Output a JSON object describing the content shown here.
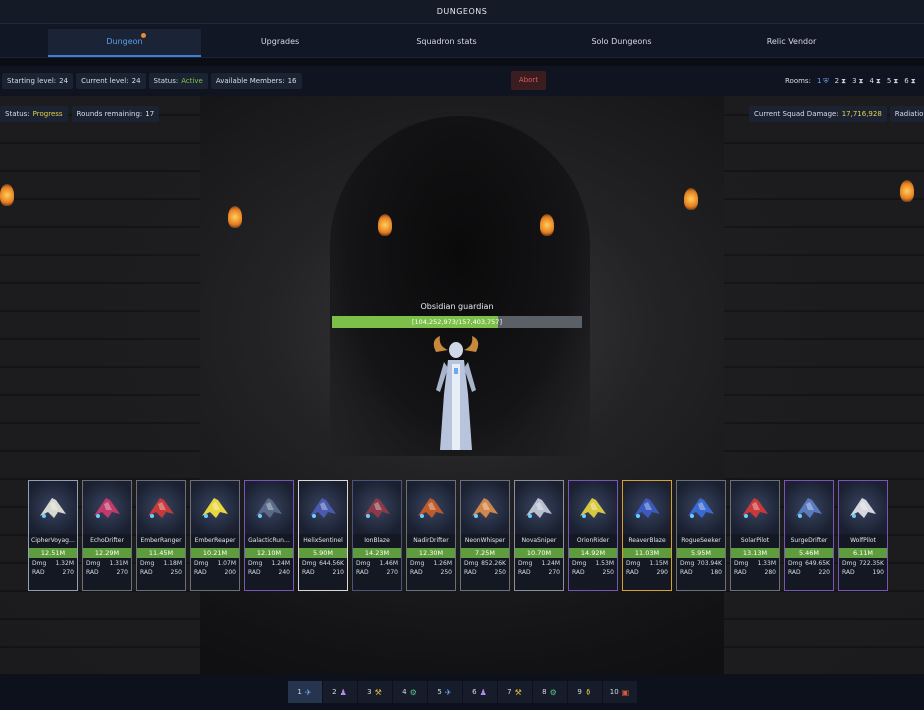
{
  "title": "DUNGEONS",
  "tabs": [
    {
      "label": "Dungeon",
      "active": true
    },
    {
      "label": "Upgrades"
    },
    {
      "label": "Squadron stats"
    },
    {
      "label": "Solo Dungeons"
    },
    {
      "label": "Relic Vendor"
    }
  ],
  "toolbar": {
    "starting_level_label": "Starting level:",
    "starting_level": "24",
    "current_level_label": "Current level:",
    "current_level": "24",
    "status_label": "Status:",
    "status": "Active",
    "members_label": "Available Members:",
    "members": "16",
    "abort_label": "Abort",
    "rooms_label": "Rooms:",
    "rooms": [
      {
        "num": "1",
        "icon": "shield-icon",
        "active": true
      },
      {
        "num": "2",
        "icon": "hourglass-icon"
      },
      {
        "num": "3",
        "icon": "hourglass-icon"
      },
      {
        "num": "4",
        "icon": "hourglass-icon"
      },
      {
        "num": "5",
        "icon": "hourglass-icon"
      },
      {
        "num": "6",
        "icon": "hourglass-icon"
      }
    ]
  },
  "battle": {
    "status_label": "Status:",
    "status": "Progress",
    "rounds_label": "Rounds remaining:",
    "rounds": "17",
    "damage_label": "Current Squad Damage:",
    "damage": "17,716,928",
    "radiation_label": "Radiatio",
    "boss_name": "Obsidian guardian",
    "boss_hp_text": "[104,252,973/157,403,757]",
    "boss_hp_fraction": 0.662
  },
  "colors": {
    "accent": "#3d7fd4",
    "green": "#7fc64a",
    "yellow": "#e3d34a",
    "abort": "#e05a5a"
  },
  "ships": [
    {
      "name": "CipherVoyag…",
      "total": "12.51M",
      "dmg": "1.32M",
      "rad": "270",
      "border": "#8fa0b8",
      "hull": "#d8d8d0"
    },
    {
      "name": "EchoDrifter",
      "total": "12.29M",
      "dmg": "1.31M",
      "rad": "270",
      "border": "#6b6f78",
      "hull": "#c03a6a"
    },
    {
      "name": "EmberRanger",
      "total": "11.45M",
      "dmg": "1.18M",
      "rad": "250",
      "border": "#6b6f78",
      "hull": "#c63a3a"
    },
    {
      "name": "EmberReaper",
      "total": "10.21M",
      "dmg": "1.07M",
      "rad": "200",
      "border": "#6b6f78",
      "hull": "#e8d840"
    },
    {
      "name": "GalacticRun…",
      "total": "12.10M",
      "dmg": "1.24M",
      "rad": "240",
      "border": "#7a55b8",
      "hull": "#5a6a88"
    },
    {
      "name": "HelixSentinel",
      "total": "5.90M",
      "dmg": "644.56K",
      "rad": "210",
      "border": "#d8d8d8",
      "hull": "#4a5ab0"
    },
    {
      "name": "IonBlaze",
      "total": "14.23M",
      "dmg": "1.46M",
      "rad": "270",
      "border": "#4a5578",
      "hull": "#8a3a48"
    },
    {
      "name": "NadirDrifter",
      "total": "12.30M",
      "dmg": "1.26M",
      "rad": "250",
      "border": "#6b6f78",
      "hull": "#c05a2a"
    },
    {
      "name": "NeonWhisper",
      "total": "7.25M",
      "dmg": "852.26K",
      "rad": "250",
      "border": "#6b6f78",
      "hull": "#d0864a"
    },
    {
      "name": "NovaSniper",
      "total": "10.70M",
      "dmg": "1.24M",
      "rad": "270",
      "border": "#8a8f98",
      "hull": "#b8c0d0"
    },
    {
      "name": "OrionRider",
      "total": "14.92M",
      "dmg": "1.53M",
      "rad": "250",
      "border": "#7a55b8",
      "hull": "#d8c840"
    },
    {
      "name": "ReaverBlaze",
      "total": "11.03M",
      "dmg": "1.15M",
      "rad": "290",
      "border": "#d8a030",
      "hull": "#3a5ac0"
    },
    {
      "name": "RogueSeeker",
      "total": "5.95M",
      "dmg": "703.94K",
      "rad": "180",
      "border": "#6b6f78",
      "hull": "#3a6ad0"
    },
    {
      "name": "SolarPilot",
      "total": "13.13M",
      "dmg": "1.33M",
      "rad": "280",
      "border": "#6b6f78",
      "hull": "#c83a3a"
    },
    {
      "name": "SurgeDrifter",
      "total": "5.46M",
      "dmg": "649.65K",
      "rad": "220",
      "border": "#7a55b8",
      "hull": "#5a7ac0"
    },
    {
      "name": "WolfPilot",
      "total": "6.11M",
      "dmg": "722.35K",
      "rad": "190",
      "border": "#7a55b8",
      "hull": "#d8d8e0"
    }
  ],
  "stat_labels": {
    "dmg": "Dmg",
    "rad": "RAD"
  },
  "pages": [
    {
      "num": "1",
      "icon": "ship-icon",
      "glyph": "✈",
      "color": "#6aa8ef",
      "active": true
    },
    {
      "num": "2",
      "icon": "people-icon",
      "glyph": "♟",
      "color": "#b88ae8"
    },
    {
      "num": "3",
      "icon": "hammer-icon",
      "glyph": "⚒",
      "color": "#e8b84a"
    },
    {
      "num": "4",
      "icon": "gear-badge-icon",
      "glyph": "⚙",
      "color": "#5ac08a"
    },
    {
      "num": "5",
      "icon": "ship-icon",
      "glyph": "✈",
      "color": "#6aa8ef"
    },
    {
      "num": "6",
      "icon": "people-icon",
      "glyph": "♟",
      "color": "#b88ae8"
    },
    {
      "num": "7",
      "icon": "hammer-icon",
      "glyph": "⚒",
      "color": "#e8b84a"
    },
    {
      "num": "8",
      "icon": "gear-badge-icon",
      "glyph": "⚙",
      "color": "#5ac08a"
    },
    {
      "num": "9",
      "icon": "potion-icon",
      "glyph": "⚱",
      "color": "#e8c84a"
    },
    {
      "num": "10",
      "icon": "chest-icon",
      "glyph": "▣",
      "color": "#d05a3a"
    }
  ]
}
